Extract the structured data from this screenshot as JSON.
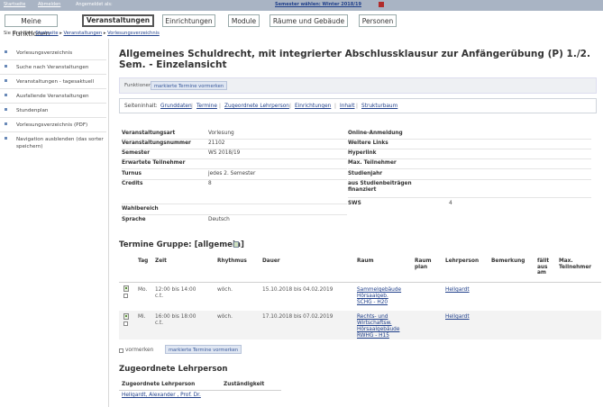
{
  "topbar": {
    "items": [
      "Startseite",
      "Abmelden",
      "Angemeldet als:",
      "Semester wählen:",
      "Winter 2018/19"
    ],
    "semester_link": "Semester wählen: Winter 2018/19"
  },
  "nav": {
    "tabs": [
      {
        "label": "Meine Funktionen",
        "active": false
      },
      {
        "label": "Veranstaltungen",
        "active": true
      },
      {
        "label": "Einrichtungen",
        "active": false
      },
      {
        "label": "Module",
        "active": false
      },
      {
        "label": "Räume und Gebäude",
        "active": false
      },
      {
        "label": "Personen",
        "active": false
      }
    ]
  },
  "breadcrumb": {
    "prefix": "Sie sind hier:",
    "items": [
      "Startseite",
      "Veranstaltungen",
      "Vorlesungsverzeichnis"
    ]
  },
  "sidebar": {
    "items": [
      {
        "label": "Vorlesungsverzeichnis"
      },
      {
        "label": "Suche nach Veranstaltungen"
      },
      {
        "label": "Veranstaltungen - tagesaktuell"
      },
      {
        "label": "Ausfallende Veranstaltungen"
      },
      {
        "label": "Stundenplan"
      },
      {
        "label": "Vorlesungsverzeichnis (PDF)"
      },
      {
        "label": "Navigation ausblenden (das sorter speichern)"
      }
    ]
  },
  "page": {
    "title": "Allgemeines Schuldrecht, mit integrierter Abschlussklausur zur Anfängerübung (P) 1./2. Sem. - Einzelansicht"
  },
  "functions": {
    "label": "Funktionen:",
    "button": "markierte Termine vormerken"
  },
  "sections": {
    "label": "Seiteninhalt:",
    "links": [
      "Grunddaten",
      "Termine",
      "Zugeordnete Lehrperson",
      "Einrichtungen",
      "Inhalt",
      "Strukturbaum"
    ]
  },
  "grunddaten": {
    "left": [
      {
        "key": "Veranstaltungsart",
        "value": "Vorlesung"
      },
      {
        "key": "Veranstaltungsnummer",
        "value": "21102"
      },
      {
        "key": "Semester",
        "value": "WS 2018/19"
      },
      {
        "key": "Erwartete Teilnehmer",
        "value": ""
      },
      {
        "key": "Turnus",
        "value": "jedes 2. Semester"
      },
      {
        "key": "Credits",
        "value": "8"
      },
      {
        "key": "Wahlbereich",
        "value": ""
      },
      {
        "key": "Sprache",
        "value": "Deutsch"
      }
    ],
    "right": [
      {
        "key": "Online-Anmeldung",
        "value": ""
      },
      {
        "key": "Weitere Links",
        "value": ""
      },
      {
        "key": "Hyperlink",
        "value": ""
      },
      {
        "key": "Max. Teilnehmer",
        "value": ""
      },
      {
        "key": "Studienjahr",
        "value": ""
      },
      {
        "key": "aus Studienbeiträgen finanziert",
        "value": ""
      },
      {
        "key": "SWS",
        "value": "4"
      }
    ]
  },
  "termine": {
    "title": "Termine Gruppe: [allgemein]",
    "headers": {
      "tag": "Tag",
      "zeit": "Zeit",
      "rhythmus": "Rhythmus",
      "dauer": "Dauer",
      "raum": "Raum",
      "raumplan": "Raum plan",
      "lehrperson": "Lehrperson",
      "bemerkung": "Bemerkung",
      "faellt_aus": "fällt aus am",
      "max_teilnehmer": "Max. Teilnehmer"
    },
    "rows": [
      {
        "tag": "Mo.",
        "zeit": "12:00 bis 14:00",
        "zeit2": "c.t.",
        "rhythmus": "wöch.",
        "dauer": "15.10.2018 bis 04.02.2019",
        "raum": [
          "Sammelgebäude",
          "Hörsaalgeb.",
          "SCHG - H20"
        ],
        "lehrperson": "Hellgardt"
      },
      {
        "tag": "Mi.",
        "zeit": "16:00 bis 18:00",
        "zeit2": "c.t.",
        "rhythmus": "wöch.",
        "dauer": "17.10.2018 bis 07.02.2019",
        "raum": [
          "Rechts- und",
          "Wirtschaftsw.",
          "Hörsaalgebäude",
          "RWHG - H15"
        ],
        "lehrperson": "Hellgardt"
      }
    ],
    "footer_checkbox": "vormerken",
    "footer_button": "markierte Termine vormerken"
  },
  "lehrperson": {
    "title": "Zugeordnete Lehrperson",
    "headers": {
      "name": "Zugeordnete Lehrperson",
      "zust": "Zuständigkeit"
    },
    "rows": [
      {
        "name": "Hellgardt, Alexander , Prof. Dr.",
        "zust": ""
      }
    ]
  },
  "colors": {
    "topbar": "#a9b4c4",
    "link": "#1f3f8a",
    "accent": "#6a8ab8"
  },
  "icons": [
    "calendar-icon",
    "bullet-icon",
    "checkbox-icon"
  ]
}
